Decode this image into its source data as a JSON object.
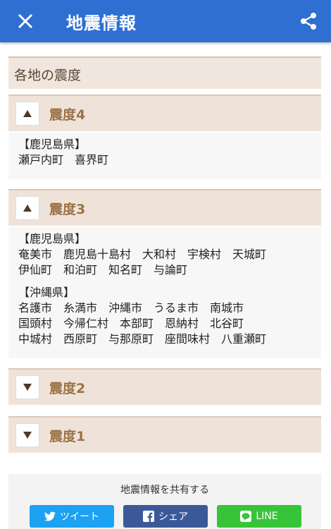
{
  "appbar": {
    "title": "地震情報"
  },
  "section": {
    "title": "各地の震度"
  },
  "groups": [
    {
      "label": "震度4",
      "expanded": true,
      "blocks": [
        {
          "pref": "【鹿児島県】",
          "lines": [
            "瀬戸内町　喜界町"
          ]
        }
      ]
    },
    {
      "label": "震度3",
      "expanded": true,
      "blocks": [
        {
          "pref": "【鹿児島県】",
          "lines": [
            "奄美市　鹿児島十島村　大和村　宇検村　天城町",
            "伊仙町　和泊町　知名町　与論町"
          ]
        },
        {
          "pref": "【沖縄県】",
          "lines": [
            "名護市　糸満市　沖縄市　うるま市　南城市",
            "国頭村　今帰仁村　本部町　恩納村　北谷町",
            "中城村　西原町　与那原町　座間味村　八重瀬町"
          ]
        }
      ]
    },
    {
      "label": "震度2",
      "expanded": false
    },
    {
      "label": "震度1",
      "expanded": false
    }
  ],
  "share": {
    "label": "地震情報を共有する",
    "twitter": "ツイート",
    "facebook": "シェア",
    "line": "LINE"
  },
  "colors": {
    "appbar": "#2f6fd2",
    "accent": "#9b7347",
    "twitter": "#1da1f2",
    "facebook": "#3b5998",
    "line": "#38c438"
  }
}
